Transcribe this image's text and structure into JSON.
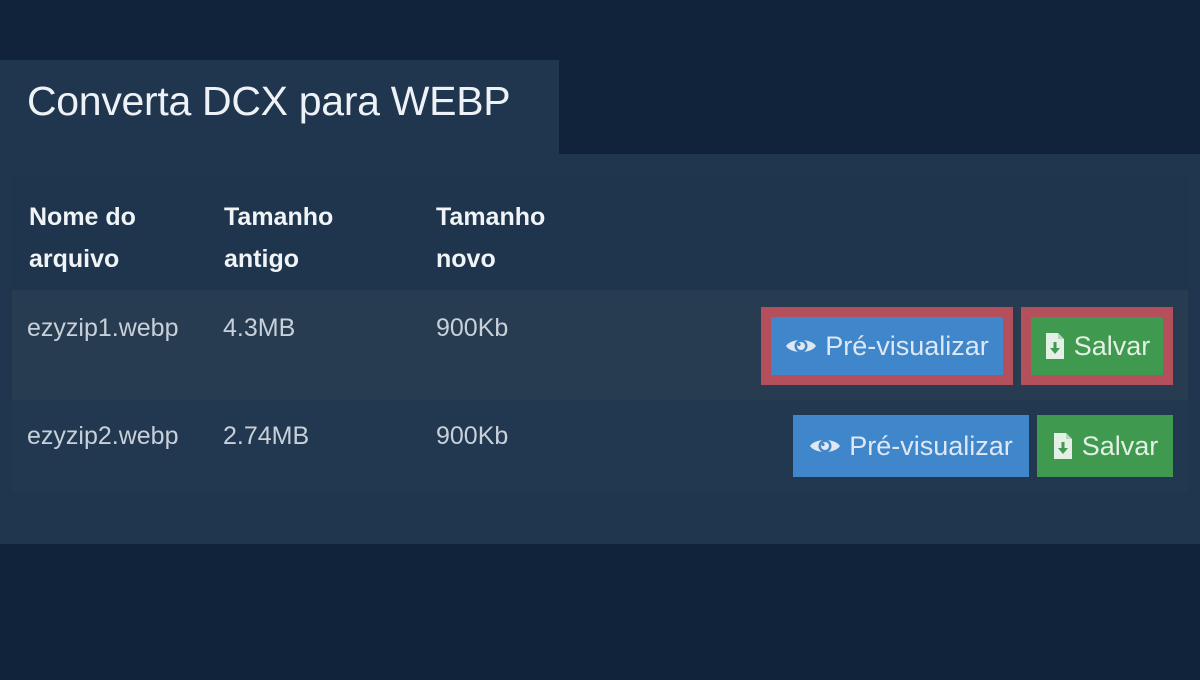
{
  "page": {
    "title": "Converta DCX para WEBP"
  },
  "table": {
    "headers": [
      {
        "line1": "Nome do",
        "line2": "arquivo"
      },
      {
        "line1": "Tamanho",
        "line2": "antigo"
      },
      {
        "line1": "Tamanho",
        "line2": "novo"
      }
    ],
    "rows": [
      {
        "filename": "ezyzip1.webp",
        "old_size": "4.3MB",
        "new_size": "900Kb",
        "preview_label": "Pré-visualizar",
        "save_label": "Salvar",
        "highlighted": true
      },
      {
        "filename": "ezyzip2.webp",
        "old_size": "2.74MB",
        "new_size": "900Kb",
        "preview_label": "Pré-visualizar",
        "save_label": "Salvar",
        "highlighted": false
      }
    ]
  },
  "icons": {
    "preview": "eye-icon",
    "save": "file-download-icon"
  },
  "colors": {
    "background": "#10233a",
    "panel": "#1f364e",
    "preview_button": "#3f86cb",
    "save_button": "#3f9a4f",
    "highlight_border": "#b4505c"
  }
}
